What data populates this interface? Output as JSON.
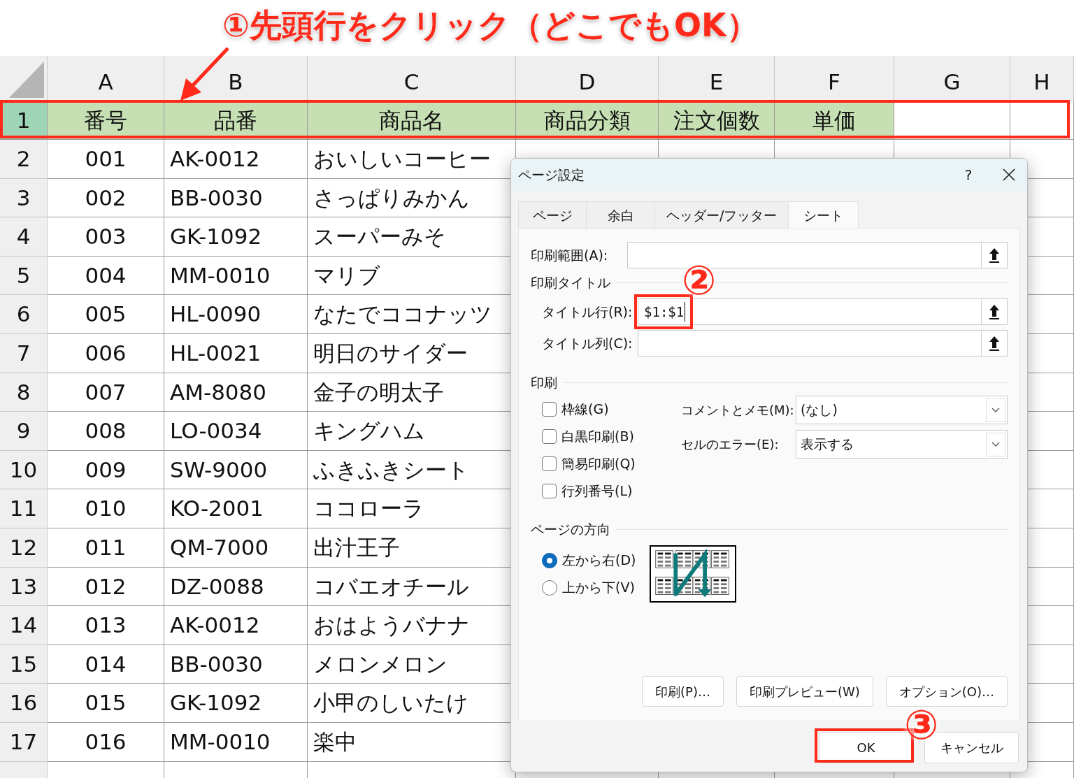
{
  "annotations": {
    "step1": "①先頭行をクリック（どこでもOK）",
    "step2": "②",
    "step3": "③"
  },
  "sheet": {
    "columns": [
      "A",
      "B",
      "C",
      "D",
      "E",
      "F",
      "G",
      "H"
    ],
    "header_row": {
      "number": "1",
      "selected": true,
      "cells": [
        "番号",
        "品番",
        "商品名",
        "商品分類",
        "注文個数",
        "単価"
      ]
    },
    "rows": [
      {
        "number": "2",
        "cells": [
          "001",
          "AK-0012",
          "おいしいコーヒー"
        ]
      },
      {
        "number": "3",
        "cells": [
          "002",
          "BB-0030",
          "さっぱりみかん"
        ]
      },
      {
        "number": "4",
        "cells": [
          "003",
          "GK-1092",
          "スーパーみそ"
        ]
      },
      {
        "number": "5",
        "cells": [
          "004",
          "MM-0010",
          "マリブ"
        ]
      },
      {
        "number": "6",
        "cells": [
          "005",
          "HL-0090",
          "なたでココナッツ"
        ]
      },
      {
        "number": "7",
        "cells": [
          "006",
          "HL-0021",
          "明日のサイダー"
        ]
      },
      {
        "number": "8",
        "cells": [
          "007",
          "AM-8080",
          "金子の明太子"
        ]
      },
      {
        "number": "9",
        "cells": [
          "008",
          "LO-0034",
          "キングハム"
        ]
      },
      {
        "number": "10",
        "cells": [
          "009",
          "SW-9000",
          "ふきふきシート"
        ]
      },
      {
        "number": "11",
        "cells": [
          "010",
          "KO-2001",
          "ココローラ"
        ]
      },
      {
        "number": "12",
        "cells": [
          "011",
          "QM-7000",
          "出汁王子"
        ]
      },
      {
        "number": "13",
        "cells": [
          "012",
          "DZ-0088",
          "コバエオチール"
        ]
      },
      {
        "number": "14",
        "cells": [
          "013",
          "AK-0012",
          "おはようバナナ"
        ]
      },
      {
        "number": "15",
        "cells": [
          "014",
          "BB-0030",
          "メロンメロン"
        ]
      },
      {
        "number": "16",
        "cells": [
          "015",
          "GK-1092",
          "小甲のしいたけ"
        ]
      },
      {
        "number": "17",
        "cells": [
          "016",
          "MM-0010",
          "楽中"
        ]
      }
    ]
  },
  "dialog": {
    "title": "ページ設定",
    "help": "?",
    "tabs": [
      {
        "label": "ページ",
        "selected": false
      },
      {
        "label": "余白",
        "selected": false
      },
      {
        "label": "ヘッダー/フッター",
        "selected": false
      },
      {
        "label": "シート",
        "selected": true
      }
    ],
    "print_area": {
      "label": "印刷範囲(A):"
    },
    "print_titles": {
      "heading": "印刷タイトル",
      "fields": [
        {
          "label": "タイトル行(R):",
          "value": "$1:$1"
        },
        {
          "label": "タイトル列(C):"
        }
      ]
    },
    "print": {
      "heading": "印刷",
      "checkboxes": [
        {
          "label": "枠線(G)",
          "checked": false
        },
        {
          "label": "白黒印刷(B)",
          "checked": false
        },
        {
          "label": "簡易印刷(Q)",
          "checked": false
        },
        {
          "label": "行列番号(L)",
          "checked": false
        }
      ],
      "selects": [
        {
          "label": "コメントとメモ(M):",
          "value": "(なし)"
        },
        {
          "label": "セルのエラー(E):",
          "value": "表示する"
        }
      ]
    },
    "page_order": {
      "heading": "ページの方向",
      "radios": [
        {
          "label": "左から右(D)",
          "selected": true
        },
        {
          "label": "上から下(V)",
          "selected": false
        }
      ]
    },
    "buttons": [
      "印刷(P)…",
      "印刷プレビュー(W)",
      "オプション(O)…"
    ],
    "footer_buttons": [
      "OK",
      "キャンセル"
    ]
  }
}
